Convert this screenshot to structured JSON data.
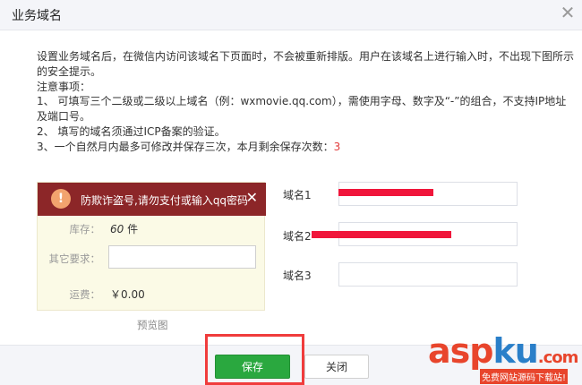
{
  "dialog": {
    "title": "业务域名",
    "close_icon": "close-icon"
  },
  "notes": {
    "intro": "设置业务域名后，在微信内访问该域名下页面时，不会被重新排版。用户在该域名上进行输入时，不出现下图所示的安全提示。",
    "heading": "注意事项：",
    "item1": "1、 可填写三个二级或二级以上域名（例：wxmovie.qq.com），需使用字母、数字及“-”的组合，不支持IP地址及端口号。",
    "item2": "2、 填写的域名须通过ICP备案的验证。",
    "item3": "3、一个自然月内最多可修改并保存三次，本月剩余保存次数：",
    "remaining_count": "3"
  },
  "preview": {
    "alert_text": "防欺诈盗号,请勿支付或输入qq密码",
    "alert_icon": "exclamation-icon",
    "stock_label": "库存：",
    "stock_value": "60",
    "stock_unit": " 件",
    "other_req_label": "其它要求：",
    "shipping_label": "运费：",
    "shipping_value": "￥0.00",
    "caption": "预览图"
  },
  "domains": {
    "label1": "域名1",
    "label2": "域名2",
    "label3": "域名3",
    "value1": "",
    "value2": "",
    "value3": ""
  },
  "footer": {
    "save_label": "保存",
    "close_label": "关闭"
  },
  "watermark": {
    "asp": "asp",
    "ku": "ku",
    "com": ".com",
    "sub": "免费网站源码下载站!"
  },
  "colors": {
    "alert_bg": "#8c2628",
    "save_green": "#2aa83f",
    "highlight_red": "#f03c3c",
    "redaction_red": "#f0163b"
  }
}
